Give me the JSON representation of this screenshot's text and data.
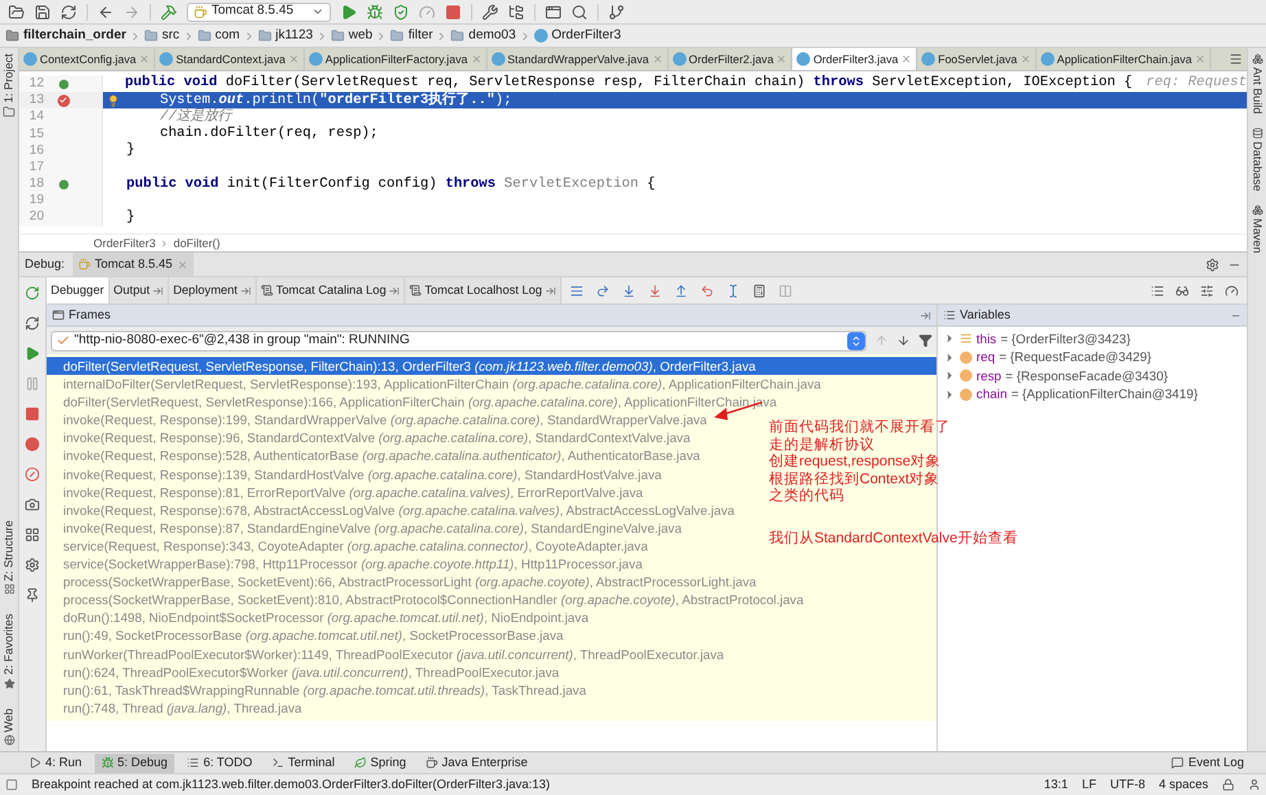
{
  "toolbar": {
    "run_config": "Tomcat 8.5.45"
  },
  "nav_path": [
    {
      "label": "filterchain_order",
      "kind": "project"
    },
    {
      "label": "src",
      "kind": "folder"
    },
    {
      "label": "com",
      "kind": "folder"
    },
    {
      "label": "jk1123",
      "kind": "folder"
    },
    {
      "label": "web",
      "kind": "folder"
    },
    {
      "label": "filter",
      "kind": "folder"
    },
    {
      "label": "demo03",
      "kind": "folder"
    },
    {
      "label": "OrderFilter3",
      "kind": "class"
    }
  ],
  "left_tool_windows": {
    "top": [
      "1: Project"
    ],
    "bottom": [
      "Z: Structure",
      "2: Favorites",
      "Web"
    ]
  },
  "right_tool_windows": [
    "Ant Build",
    "Database",
    "Maven"
  ],
  "editor_tabs": [
    {
      "label": "ContextConfig.java",
      "selected": false
    },
    {
      "label": "StandardContext.java",
      "selected": false
    },
    {
      "label": "ApplicationFilterFactory.java",
      "selected": false
    },
    {
      "label": "StandardWrapperValve.java",
      "selected": false
    },
    {
      "label": "OrderFilter2.java",
      "selected": false
    },
    {
      "label": "OrderFilter3.java",
      "selected": true
    },
    {
      "label": "FooServlet.java",
      "selected": false
    },
    {
      "label": "ApplicationFilterChain.java",
      "selected": false
    }
  ],
  "editor": {
    "lines": [
      {
        "number": "12",
        "current": false,
        "breakpoint": false,
        "overrides": true,
        "tokens": [
          {
            "kind": "keyword",
            "text": "public void "
          },
          {
            "kind": "plain",
            "text": "doFilter(ServletRequest req, ServletResponse resp, FilterChain chain) "
          },
          {
            "kind": "keyword",
            "text": "throws "
          },
          {
            "kind": "plain",
            "text": "ServletException, IOException {"
          },
          {
            "kind": "hint",
            "text": "req: Request"
          }
        ]
      },
      {
        "number": "13",
        "current": true,
        "breakpoint": true,
        "overrides": false,
        "tokens": [
          {
            "kind": "plain",
            "text": "    System."
          },
          {
            "kind": "field",
            "text": "out"
          },
          {
            "kind": "plain",
            "text": ".println("
          },
          {
            "kind": "string",
            "text": "\"orderFilter3执行了..\""
          },
          {
            "kind": "plain",
            "text": ");"
          }
        ]
      },
      {
        "number": "14",
        "current": false,
        "breakpoint": false,
        "overrides": false,
        "tokens": [
          {
            "kind": "comment",
            "text": "    //这是放行"
          }
        ]
      },
      {
        "number": "15",
        "current": false,
        "breakpoint": false,
        "overrides": false,
        "tokens": [
          {
            "kind": "plain",
            "text": "    chain.doFilter(req, resp);"
          }
        ]
      },
      {
        "number": "16",
        "current": false,
        "breakpoint": false,
        "overrides": false,
        "tokens": [
          {
            "kind": "plain",
            "text": "}"
          }
        ]
      },
      {
        "number": "17",
        "current": false,
        "breakpoint": false,
        "overrides": false
      },
      {
        "number": "18",
        "current": false,
        "breakpoint": false,
        "overrides": true,
        "tokens": [
          {
            "kind": "keyword",
            "text": "public void "
          },
          {
            "kind": "plain",
            "text": "init(FilterConfig config) "
          },
          {
            "kind": "keyword",
            "text": "throws "
          },
          {
            "kind": "unused",
            "text": "ServletException"
          },
          {
            "kind": "plain",
            "text": " {"
          }
        ]
      },
      {
        "number": "19",
        "current": false,
        "breakpoint": false,
        "overrides": false
      },
      {
        "number": "20",
        "current": false,
        "breakpoint": false,
        "overrides": false,
        "tokens": [
          {
            "kind": "plain",
            "text": "}"
          }
        ]
      }
    ],
    "breadcrumb": [
      "OrderFilter3",
      "doFilter()"
    ]
  },
  "debug": {
    "label": "Debug:",
    "session": "Tomcat 8.5.45",
    "tabs": [
      {
        "label": "Debugger",
        "selected": true,
        "pinned": false,
        "kind": "plain"
      },
      {
        "label": "Output",
        "selected": false,
        "pinned": true,
        "kind": "plain"
      },
      {
        "label": "Deployment",
        "selected": false,
        "pinned": true,
        "kind": "plain"
      },
      {
        "label": "Tomcat Catalina Log",
        "selected": false,
        "pinned": true,
        "kind": "log"
      },
      {
        "label": "Tomcat Localhost Log",
        "selected": false,
        "pinned": true,
        "kind": "log"
      }
    ],
    "frames": {
      "title": "Frames",
      "thread": "\"http-nio-8080-exec-6\"@2,438 in group \"main\": RUNNING",
      "items": [
        {
          "text": "doFilter(ServletRequest, ServletResponse, FilterChain):13, OrderFilter3 *(com.jk1123.web.filter.demo03)*, OrderFilter3.java",
          "selected": true
        },
        {
          "text": "internalDoFilter(ServletRequest, ServletResponse):193, ApplicationFilterChain *(org.apache.catalina.core)*, ApplicationFilterChain.java",
          "selected": false
        },
        {
          "text": "doFilter(ServletRequest, ServletResponse):166, ApplicationFilterChain *(org.apache.catalina.core)*, ApplicationFilterChain.java",
          "selected": false
        },
        {
          "text": "invoke(Request, Response):199, StandardWrapperValve *(org.apache.catalina.core)*, StandardWrapperValve.java",
          "selected": false
        },
        {
          "text": "invoke(Request, Response):96, StandardContextValve *(org.apache.catalina.core)*, StandardContextValve.java",
          "selected": false
        },
        {
          "text": "invoke(Request, Response):528, AuthenticatorBase *(org.apache.catalina.authenticator)*, AuthenticatorBase.java",
          "selected": false
        },
        {
          "text": "invoke(Request, Response):139, StandardHostValve *(org.apache.catalina.core)*, StandardHostValve.java",
          "selected": false
        },
        {
          "text": "invoke(Request, Response):81, ErrorReportValve *(org.apache.catalina.valves)*, ErrorReportValve.java",
          "selected": false
        },
        {
          "text": "invoke(Request, Response):678, AbstractAccessLogValve *(org.apache.catalina.valves)*, AbstractAccessLogValve.java",
          "selected": false
        },
        {
          "text": "invoke(Request, Response):87, StandardEngineValve *(org.apache.catalina.core)*, StandardEngineValve.java",
          "selected": false
        },
        {
          "text": "service(Request, Response):343, CoyoteAdapter *(org.apache.catalina.connector)*, CoyoteAdapter.java",
          "selected": false
        },
        {
          "text": "service(SocketWrapperBase):798, Http11Processor *(org.apache.coyote.http11)*, Http11Processor.java",
          "selected": false
        },
        {
          "text": "process(SocketWrapperBase, SocketEvent):66, AbstractProcessorLight *(org.apache.coyote)*, AbstractProcessorLight.java",
          "selected": false
        },
        {
          "text": "process(SocketWrapperBase, SocketEvent):810, AbstractProtocol$ConnectionHandler *(org.apache.coyote)*, AbstractProtocol.java",
          "selected": false
        },
        {
          "text": "doRun():1498, NioEndpoint$SocketProcessor *(org.apache.tomcat.util.net)*, NioEndpoint.java",
          "selected": false
        },
        {
          "text": "run():49, SocketProcessorBase *(org.apache.tomcat.util.net)*, SocketProcessorBase.java",
          "selected": false
        },
        {
          "text": "runWorker(ThreadPoolExecutor$Worker):1149, ThreadPoolExecutor *(java.util.concurrent)*, ThreadPoolExecutor.java",
          "selected": false
        },
        {
          "text": "run():624, ThreadPoolExecutor$Worker *(java.util.concurrent)*, ThreadPoolExecutor.java",
          "selected": false
        },
        {
          "text": "run():61, TaskThread$WrappingRunnable *(org.apache.tomcat.util.threads)*, TaskThread.java",
          "selected": false
        },
        {
          "text": "run():748, Thread *(java.lang)*, Thread.java",
          "selected": false
        }
      ],
      "notes": [
        [
          "前面代码我们就不展开看了",
          "走的是解析协议",
          "创建request,response对象",
          "根据路径找到Context对象",
          "之类的代码"
        ],
        [
          "我们从StandardContextValve开始查看"
        ]
      ]
    },
    "variables": {
      "title": "Variables",
      "items": [
        {
          "name": "this",
          "value": "= {OrderFilter3@3423}",
          "kind": "object"
        },
        {
          "name": "req",
          "value": "= {RequestFacade@3429}",
          "kind": "parameter"
        },
        {
          "name": "resp",
          "value": "= {ResponseFacade@3430}",
          "kind": "parameter"
        },
        {
          "name": "chain",
          "value": "= {ApplicationFilterChain@3419}",
          "kind": "parameter"
        }
      ]
    }
  },
  "bottom_tools": [
    {
      "label": "4: Run",
      "kind": "run",
      "selected": false
    },
    {
      "label": "5: Debug",
      "kind": "debug",
      "selected": true
    },
    {
      "label": "6: TODO",
      "kind": "todo",
      "selected": false
    },
    {
      "label": "Terminal",
      "kind": "terminal",
      "selected": false
    },
    {
      "label": "Spring",
      "kind": "spring",
      "selected": false
    },
    {
      "label": "Java Enterprise",
      "kind": "enterprise",
      "selected": false
    }
  ],
  "event_log": "Event Log",
  "status_bar": {
    "message": "Breakpoint reached at com.jk1123.web.filter.demo03.OrderFilter3.doFilter(OrderFilter3.java:13)",
    "position": "13:1",
    "line_separator": "LF",
    "encoding": "UTF-8",
    "indent": "4 spaces"
  }
}
